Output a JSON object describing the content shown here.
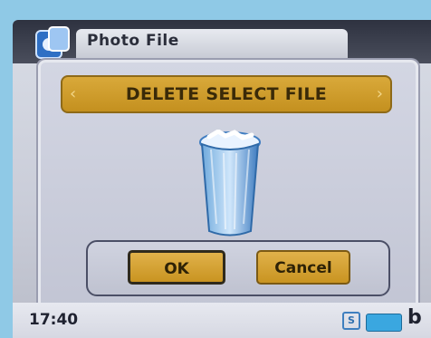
{
  "app": {
    "title": "Photo File"
  },
  "dialog": {
    "title": "DELETE SELECT FILE",
    "ok_label": "OK",
    "cancel_label": "Cancel"
  },
  "statusbar": {
    "time": "17:40",
    "sd_label": "S",
    "extra_label": "b"
  },
  "icons": {
    "app": "photo-file-icon",
    "trash": "trash-bin-icon",
    "sd": "sd-card-icon",
    "battery": "battery-icon",
    "nav_left": "chevron-left-icon",
    "nav_right": "chevron-right-icon"
  },
  "colors": {
    "accent": "#d4a032",
    "background": "#8fc9e6"
  }
}
